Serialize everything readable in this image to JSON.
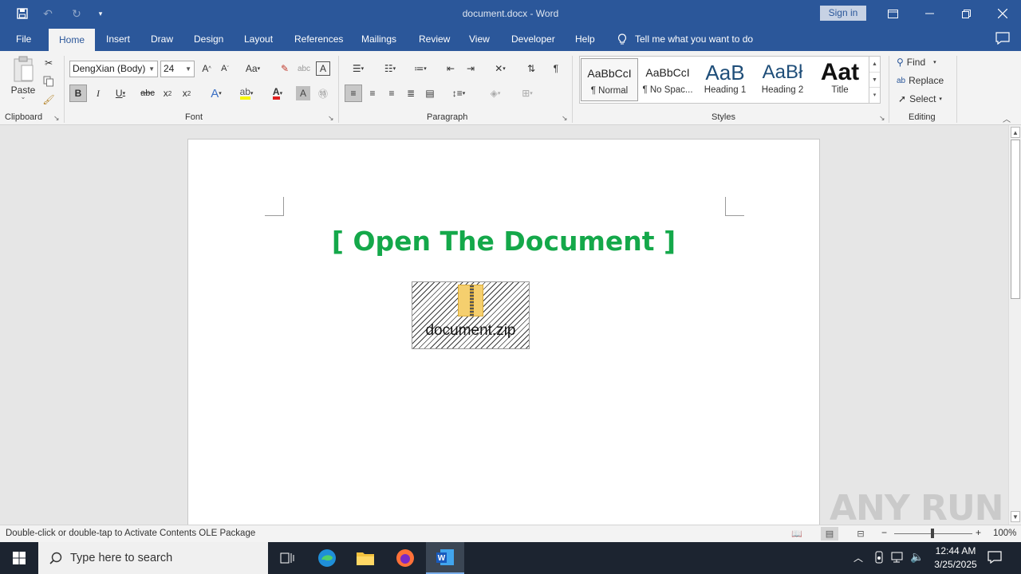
{
  "window": {
    "title": "document.docx  -  Word",
    "sign_in": "Sign in"
  },
  "tabs": [
    "File",
    "Home",
    "Insert",
    "Draw",
    "Design",
    "Layout",
    "References",
    "Mailings",
    "Review",
    "View",
    "Developer",
    "Help"
  ],
  "active_tab": "Home",
  "tell_me": "Tell me what you want to do",
  "ribbon": {
    "clipboard": {
      "paste": "Paste",
      "label": "Clipboard"
    },
    "font": {
      "name": "DengXian (Body)",
      "size": "24",
      "label": "Font"
    },
    "paragraph": {
      "label": "Paragraph"
    },
    "styles": {
      "label": "Styles",
      "items": [
        {
          "preview": "AaBbCcI",
          "name": "¶ Normal"
        },
        {
          "preview": "AaBbCcI",
          "name": "¶ No Spac..."
        },
        {
          "preview": "AaB",
          "name": "Heading 1"
        },
        {
          "preview": "AaBł",
          "name": "Heading 2"
        },
        {
          "preview": "Aat",
          "name": "Title"
        }
      ]
    },
    "editing": {
      "find": "Find",
      "replace": "Replace",
      "select": "Select",
      "label": "Editing"
    }
  },
  "document": {
    "headline": "[ Open The Document ]",
    "embedded_object": "document.zip"
  },
  "status": {
    "message": "Double-click or double-tap to Activate Contents OLE Package",
    "zoom": "100%"
  },
  "watermark": "ANY RUN",
  "taskbar": {
    "search_placeholder": "Type here to search",
    "time": "12:44 AM",
    "date": "3/25/2025"
  },
  "colors": {
    "word_blue": "#2b579a",
    "headline_green": "#14a84a"
  }
}
